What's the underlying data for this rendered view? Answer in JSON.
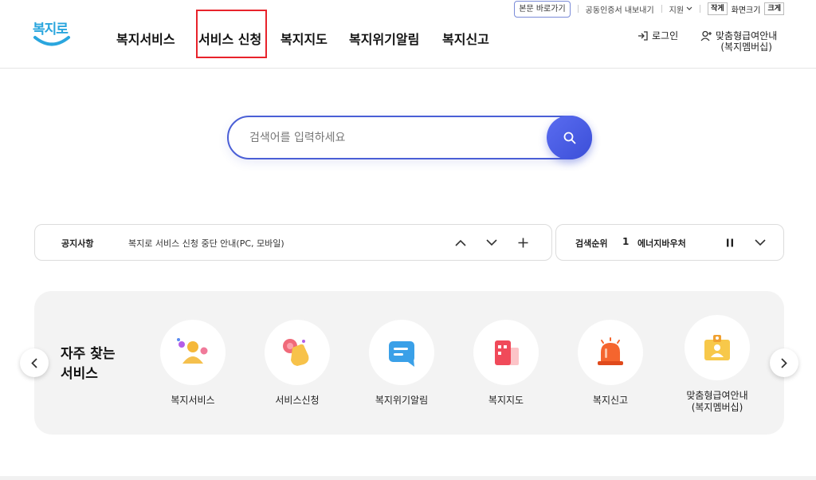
{
  "header": {
    "util": {
      "skip_label": "본문 바로가기",
      "cert_label": "공동인증서 내보내기",
      "support_label": "지원",
      "font_small": "작게",
      "font_label": "화면크기",
      "font_large": "크게"
    },
    "logo_text": "복지로",
    "nav": [
      "복지서비스",
      "서비스 신청",
      "복지지도",
      "복지위기알림",
      "복지신고"
    ],
    "login_label": "로그인",
    "member_label_1": "맞춤형급여안내",
    "member_label_2": "(복지멤버십)"
  },
  "search": {
    "placeholder": "검색어를 입력하세요"
  },
  "notice": {
    "title": "공지사항",
    "text": "복지로 서비스 신청 중단 안내(PC, 모바일)"
  },
  "ranking": {
    "title": "검색순위",
    "rank": "1",
    "keyword": "에너지바우처"
  },
  "frequent": {
    "title_1": "자주 찾는",
    "title_2": "서비스",
    "items": [
      {
        "label": "복지서비스",
        "icon": "person-icon"
      },
      {
        "label": "서비스신청",
        "icon": "hand-touch-icon"
      },
      {
        "label": "복지위기알림",
        "icon": "message-icon"
      },
      {
        "label": "복지지도",
        "icon": "building-icon"
      },
      {
        "label": "복지신고",
        "icon": "siren-icon"
      },
      {
        "label": "맞춤형급여안내",
        "label2": "(복지멤버십)",
        "icon": "id-card-icon"
      }
    ]
  },
  "colors": {
    "brand_blue": "#2aa6de",
    "search_border": "#4a5fd6",
    "highlight_red": "#e8232b"
  }
}
